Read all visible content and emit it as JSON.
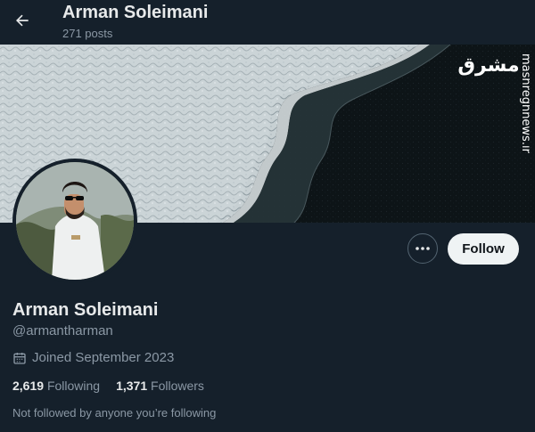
{
  "header": {
    "title": "Arman Soleimani",
    "posts": "271 posts",
    "back_icon": "arrow-left-icon"
  },
  "watermark": {
    "logo_text": "مشرق",
    "site": "mashreghnews.ir"
  },
  "profile": {
    "name": "Arman Soleimani",
    "handle": "@armantharman",
    "joined": "Joined September 2023",
    "following_count": "2,619",
    "following_label": "Following",
    "followers_count": "1,371",
    "followers_label": "Followers",
    "not_followed": "Not followed by anyone you’re following"
  },
  "actions": {
    "follow_label": "Follow",
    "more_icon": "more-dots-icon"
  },
  "colors": {
    "background": "#15202b",
    "text_primary": "#e7e9ea",
    "text_secondary": "#8b98a5",
    "follow_button_bg": "#eff3f4"
  }
}
